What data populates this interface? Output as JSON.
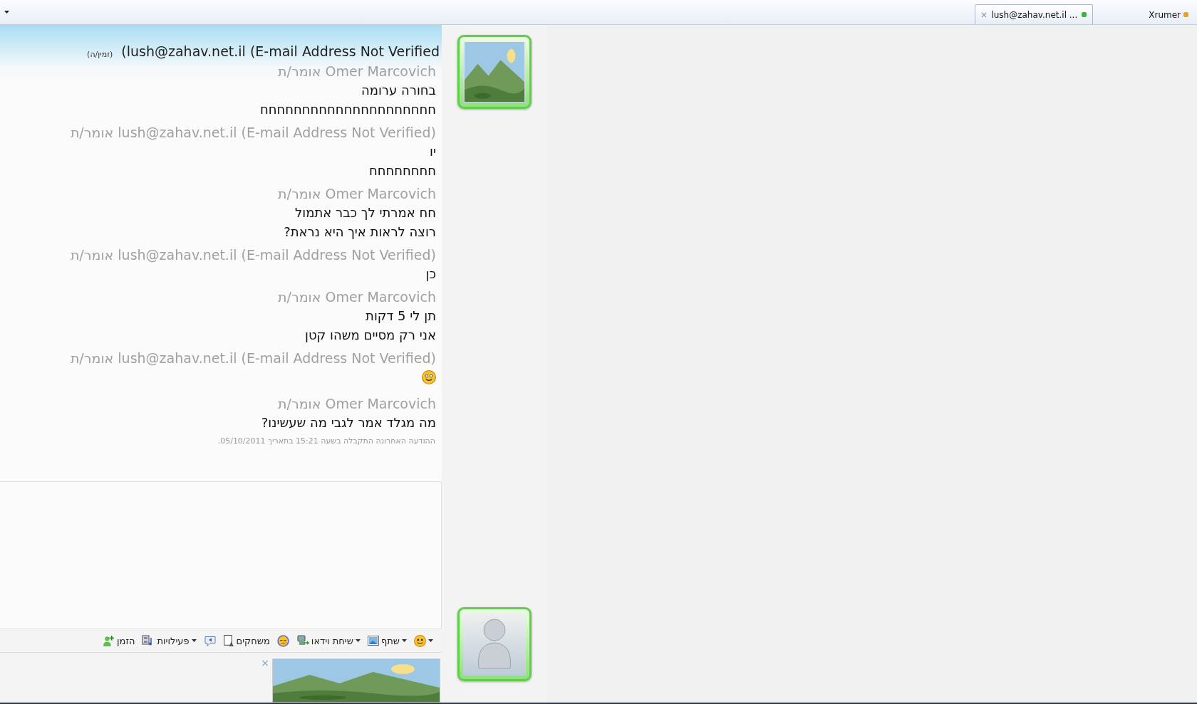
{
  "top_bar": {
    "tabs": [
      {
        "label": "lush@zahav.net.il ...",
        "selected": true,
        "color": "#3cb43c"
      }
    ],
    "account": {
      "label": "Xrumer",
      "color": "#f0a020"
    }
  },
  "header": {
    "contact": "(lush@zahav.net.il (E-mail Address Not Verified",
    "status": "(זמין/ה)"
  },
  "messages": [
    {
      "sender": "אומר/ת Omer Marcovich",
      "lines": [
        {
          "kind": "text",
          "text": "בחורה ערומה"
        },
        {
          "kind": "text",
          "text": "חחחחחחחחחחחחחחחחחחחחח"
        }
      ]
    },
    {
      "sender": "אומר/ת lush@zahav.net.il (E-mail Address Not Verified)",
      "lines": [
        {
          "kind": "text",
          "text": "יו"
        },
        {
          "kind": "text",
          "text": "חחחחחחחח"
        }
      ]
    },
    {
      "sender": "אומר/ת Omer Marcovich",
      "lines": [
        {
          "kind": "text",
          "text": "חח אמרתי לך כבר אתמול"
        },
        {
          "kind": "text",
          "text": "רוצה לראות איך היא נראת?"
        }
      ]
    },
    {
      "sender": "אומר/ת lush@zahav.net.il (E-mail Address Not Verified)",
      "lines": [
        {
          "kind": "text",
          "text": "כן"
        }
      ]
    },
    {
      "sender": "אומר/ת Omer Marcovich",
      "lines": [
        {
          "kind": "text",
          "text": "תן לי 5 דקות"
        },
        {
          "kind": "text",
          "text": "אני רק מסיים משהו קטן"
        }
      ]
    },
    {
      "sender": "אומר/ת lush@zahav.net.il (E-mail Address Not Verified)",
      "lines": [
        {
          "kind": "emoticon"
        }
      ]
    },
    {
      "sender": "אומר/ת Omer Marcovich",
      "lines": [
        {
          "kind": "text",
          "text": "מה מגלד אמר לגבי מה שעשינו?"
        }
      ]
    }
  ],
  "last_received": "ההודעה האחרונה התקבלה בשעה 15:21 בתאריך 05/10/2011.",
  "toolbar": [
    {
      "kind": "emoticons",
      "dropdown": true
    },
    {
      "kind": "share",
      "label": "שתף",
      "dropdown": true
    },
    {
      "kind": "video",
      "label": "שיחת וידאו",
      "dropdown": true
    },
    {
      "kind": "wink",
      "dropdown": false
    },
    {
      "kind": "games",
      "label": "משחקים",
      "dropdown": false
    },
    {
      "kind": "nudge",
      "dropdown": false
    },
    {
      "kind": "activities",
      "label": "פעילויות",
      "dropdown": true
    },
    {
      "kind": "invite",
      "label": "הזמן",
      "dropdown": false
    }
  ],
  "ad": {
    "kind": "picture",
    "close": "×"
  },
  "avatars": [
    {
      "kind": "picture"
    },
    {
      "kind": "default"
    }
  ]
}
